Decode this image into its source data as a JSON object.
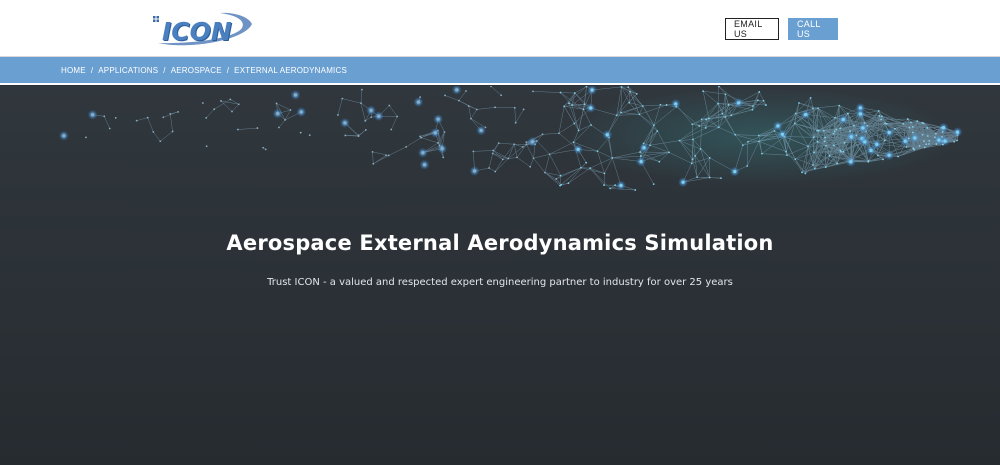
{
  "header": {
    "logo_text": "ICON",
    "email_label": "EMAIL US",
    "call_label": "CALL US"
  },
  "breadcrumb": [
    {
      "label": "HOME"
    },
    {
      "label": "APPLICATIONS"
    },
    {
      "label": "AEROSPACE"
    },
    {
      "label": "EXTERNAL AERODYNAMICS"
    }
  ],
  "breadcrumb_separator": "/",
  "hero": {
    "title": "Aerospace External Aerodynamics Simulation",
    "subtitle": "Trust ICON - a valued and respected expert engineering partner to industry for over 25 years"
  },
  "colors": {
    "accent": "#6a9fd1",
    "hero_bg": "#2b3136",
    "mesh_line": "#8fb6cf",
    "mesh_node": "#4aa3ff",
    "mesh_glow": "#3fd3d6"
  }
}
